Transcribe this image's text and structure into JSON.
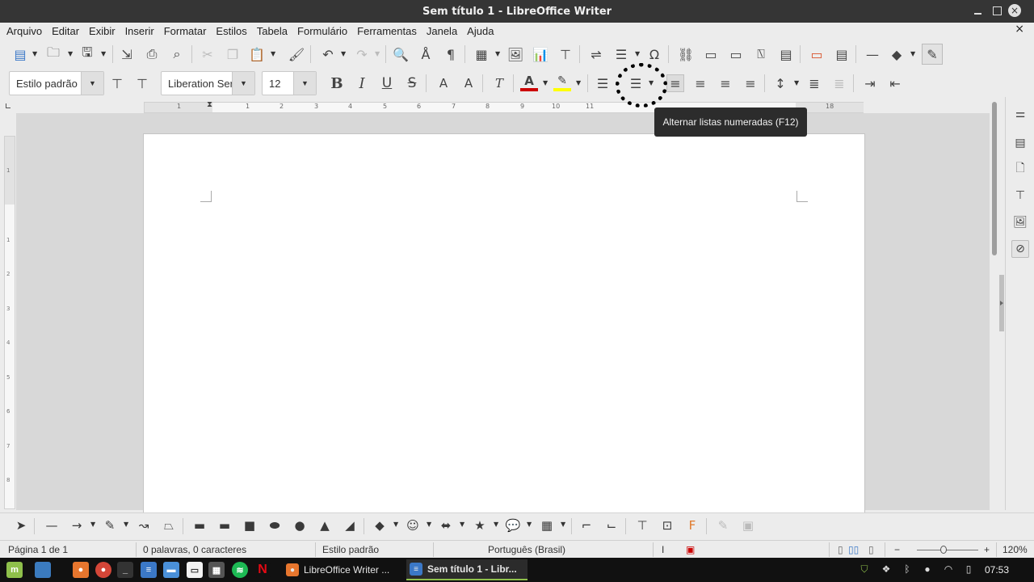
{
  "window": {
    "title": "Sem título 1 - LibreOffice Writer",
    "close_symbol": "×"
  },
  "menu": [
    "Arquivo",
    "Editar",
    "Exibir",
    "Inserir",
    "Formatar",
    "Estilos",
    "Tabela",
    "Formulário",
    "Ferramentas",
    "Janela",
    "Ajuda"
  ],
  "formatting": {
    "paragraph_style": "Estilo padrão",
    "font_name": "Liberation Ser",
    "font_size": "12",
    "bold": "B",
    "italic": "I",
    "underline": "U",
    "strike": "S",
    "superscript": "A",
    "subscript": "A",
    "clear": "T",
    "font_color": "#cc0000",
    "highlight_color": "#ffff00"
  },
  "ruler": {
    "numbers": [
      "1",
      "1",
      "2",
      "3",
      "4",
      "5",
      "6",
      "7",
      "8",
      "9",
      "10",
      "11",
      "18"
    ]
  },
  "vruler": {
    "numbers": [
      "1",
      "1",
      "2",
      "3",
      "4",
      "5",
      "6",
      "7",
      "8"
    ]
  },
  "tooltip": "Alternar listas numeradas (F12)",
  "status": {
    "page": "Página 1 de 1",
    "words": "0 palavras, 0 caracteres",
    "style": "Estilo padrão",
    "language": "Português (Brasil)",
    "insert_mode": "I",
    "zoom": "120%",
    "zoom_minus": "−",
    "zoom_plus": "+"
  },
  "taskbar": {
    "tasks": [
      {
        "label": "LibreOffice Writer ...",
        "active": false
      },
      {
        "label": "Sem título 1 - Libr...",
        "active": true
      }
    ],
    "clock": "07:53"
  },
  "colors": {
    "accent_green": "#8fc04b",
    "dark_title": "#353535"
  }
}
